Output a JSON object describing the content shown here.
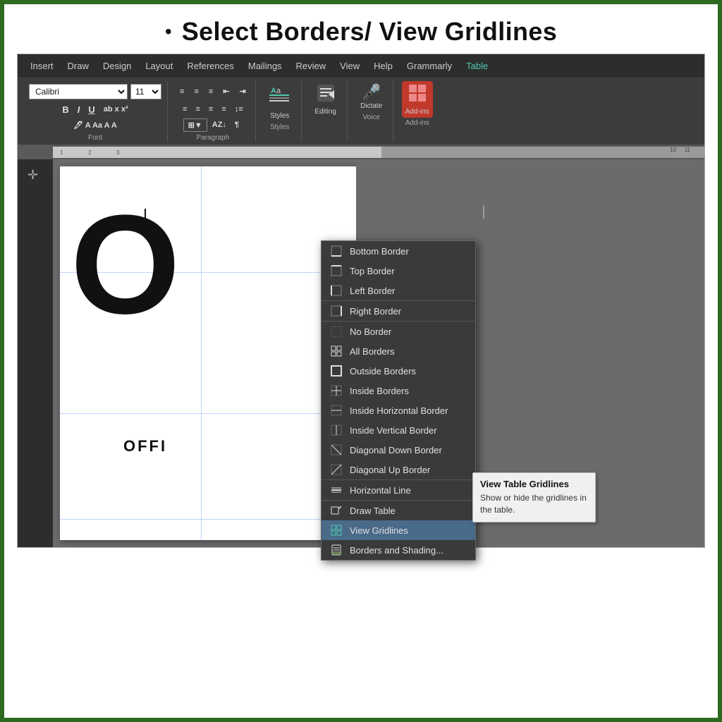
{
  "title": {
    "bullet": "•",
    "text": "Select Borders/ View Gridlines"
  },
  "ribbon": {
    "tabs": [
      {
        "label": "Insert",
        "active": false
      },
      {
        "label": "Draw",
        "active": false
      },
      {
        "label": "Design",
        "active": false
      },
      {
        "label": "Layout",
        "active": false
      },
      {
        "label": "References",
        "active": false
      },
      {
        "label": "Mailings",
        "active": false
      },
      {
        "label": "Review",
        "active": false
      },
      {
        "label": "View",
        "active": false
      },
      {
        "label": "Help",
        "active": false
      },
      {
        "label": "Grammarly",
        "active": false
      },
      {
        "label": "Table",
        "active": true
      }
    ],
    "font": {
      "family": "Calibri",
      "size": "11"
    },
    "groups": {
      "font_label": "Font",
      "styles_label": "Styles",
      "editing_label": "Editing",
      "voice_label": "Voice",
      "addins_label": "Add-ins"
    },
    "buttons": {
      "bold": "B",
      "italic": "I",
      "underline": "U",
      "styles": "Styles",
      "editing": "Editing",
      "dictate": "Dictate",
      "addins": "Add-ins"
    }
  },
  "dropdown": {
    "items": [
      {
        "id": "bottom-border",
        "label": "Bottom Border",
        "icon": "bottom"
      },
      {
        "id": "top-border",
        "label": "Top Border",
        "icon": "top"
      },
      {
        "id": "left-border",
        "label": "Left Border",
        "icon": "left"
      },
      {
        "id": "right-border",
        "label": "Right Border",
        "icon": "right"
      },
      {
        "id": "no-border",
        "label": "No Border",
        "icon": "none",
        "separator": true
      },
      {
        "id": "all-borders",
        "label": "All Borders",
        "icon": "all"
      },
      {
        "id": "outside-borders",
        "label": "Outside Borders",
        "icon": "outside"
      },
      {
        "id": "inside-borders",
        "label": "Inside Borders",
        "icon": "inside"
      },
      {
        "id": "inside-horizontal",
        "label": "Inside Horizontal Border",
        "icon": "horiz"
      },
      {
        "id": "inside-vertical",
        "label": "Inside Vertical Border",
        "icon": "vert"
      },
      {
        "id": "diagonal-down",
        "label": "Diagonal Down Border",
        "icon": "diag-down"
      },
      {
        "id": "diagonal-up",
        "label": "Diagonal Up Border",
        "icon": "diag-up"
      },
      {
        "id": "horizontal-line",
        "label": "Horizontal Line",
        "icon": "hline",
        "separator": true
      },
      {
        "id": "draw-table",
        "label": "Draw Table",
        "icon": "draw",
        "separator": true
      },
      {
        "id": "view-gridlines",
        "label": "View Gridlines",
        "icon": "grid",
        "active": true
      },
      {
        "id": "borders-shading",
        "label": "Borders and Shading...",
        "icon": "shading"
      }
    ]
  },
  "tooltip": {
    "title": "View Table Gridlines",
    "description": "Show or hide the gridlines in the table."
  },
  "document": {
    "letter": "(",
    "text": "OFFI"
  }
}
